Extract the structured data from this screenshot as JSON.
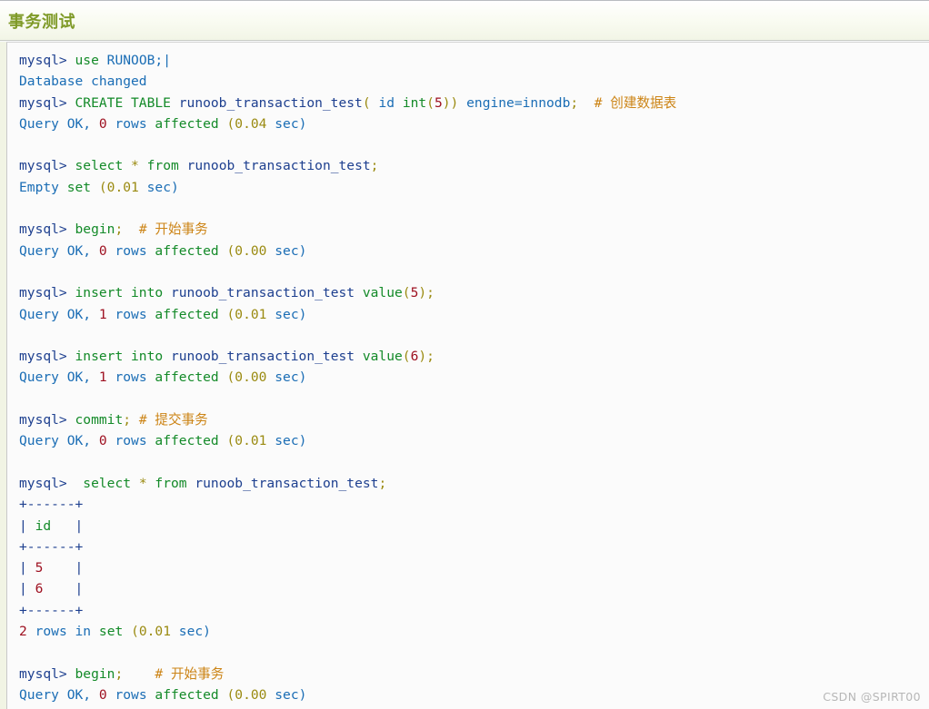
{
  "header": {
    "title": "事务测试",
    "title_color": "#7f9a28"
  },
  "watermark": {
    "text": "CSDN @SPIRT00"
  },
  "colors": {
    "prompt": "#1d3f8f",
    "keyword": "#138a28",
    "identifier": "#1a6db5",
    "number": "#9e1020",
    "punctuation": "#9a8a10",
    "comment": "#cc8416",
    "table_border": "#1d3f8f",
    "code_background": "#fbfbfb",
    "page_background": "#f1f4e4",
    "header_background": "#f2f5e6"
  },
  "terminal": {
    "lines": [
      {
        "id": "l01",
        "tokens": [
          {
            "t": "mysql>",
            "c": "prompt"
          },
          {
            "t": " ",
            "c": "plain"
          },
          {
            "t": "use",
            "c": "kw"
          },
          {
            "t": " ",
            "c": "plain"
          },
          {
            "t": "RUNOOB;",
            "c": "ident"
          },
          {
            "t": "|",
            "c": "ident"
          }
        ]
      },
      {
        "id": "l02",
        "tokens": [
          {
            "t": "Database changed",
            "c": "plain"
          }
        ]
      },
      {
        "id": "l03",
        "tokens": [
          {
            "t": "mysql>",
            "c": "prompt"
          },
          {
            "t": " ",
            "c": "plain"
          },
          {
            "t": "CREATE TABLE",
            "c": "kw"
          },
          {
            "t": " ",
            "c": "plain"
          },
          {
            "t": "runoob_transaction_test",
            "c": "tbl"
          },
          {
            "t": "(",
            "c": "punct"
          },
          {
            "t": " ",
            "c": "plain"
          },
          {
            "t": "id",
            "c": "ident"
          },
          {
            "t": " ",
            "c": "plain"
          },
          {
            "t": "int",
            "c": "kw"
          },
          {
            "t": "(",
            "c": "punct"
          },
          {
            "t": "5",
            "c": "num"
          },
          {
            "t": "))",
            "c": "punct"
          },
          {
            "t": " engine=innodb",
            "c": "ident"
          },
          {
            "t": ";",
            "c": "punct"
          },
          {
            "t": "  # 创建数据表",
            "c": "comment"
          }
        ]
      },
      {
        "id": "l04",
        "tokens": [
          {
            "t": "Query OK,",
            "c": "plain"
          },
          {
            "t": " ",
            "c": "plain"
          },
          {
            "t": "0",
            "c": "num"
          },
          {
            "t": " ",
            "c": "plain"
          },
          {
            "t": "rows",
            "c": "plain"
          },
          {
            "t": " ",
            "c": "plain"
          },
          {
            "t": "affected",
            "c": "kw"
          },
          {
            "t": " ",
            "c": "plain"
          },
          {
            "t": "(0.04",
            "c": "punct"
          },
          {
            "t": " ",
            "c": "plain"
          },
          {
            "t": "sec)",
            "c": "plain"
          }
        ]
      },
      {
        "id": "l05",
        "tokens": []
      },
      {
        "id": "l06",
        "tokens": [
          {
            "t": "mysql>",
            "c": "prompt"
          },
          {
            "t": " ",
            "c": "plain"
          },
          {
            "t": "select",
            "c": "kw"
          },
          {
            "t": " ",
            "c": "plain"
          },
          {
            "t": "*",
            "c": "punct"
          },
          {
            "t": " ",
            "c": "plain"
          },
          {
            "t": "from",
            "c": "kw"
          },
          {
            "t": " ",
            "c": "plain"
          },
          {
            "t": "runoob_transaction_test",
            "c": "tbl"
          },
          {
            "t": ";",
            "c": "punct"
          }
        ]
      },
      {
        "id": "l07",
        "tokens": [
          {
            "t": "Empty",
            "c": "plain"
          },
          {
            "t": " ",
            "c": "plain"
          },
          {
            "t": "set",
            "c": "kw"
          },
          {
            "t": " ",
            "c": "plain"
          },
          {
            "t": "(0.01",
            "c": "punct"
          },
          {
            "t": " ",
            "c": "plain"
          },
          {
            "t": "sec)",
            "c": "plain"
          }
        ]
      },
      {
        "id": "l08",
        "tokens": []
      },
      {
        "id": "l09",
        "tokens": [
          {
            "t": "mysql>",
            "c": "prompt"
          },
          {
            "t": " ",
            "c": "plain"
          },
          {
            "t": "begin",
            "c": "kw"
          },
          {
            "t": ";",
            "c": "punct"
          },
          {
            "t": "  # 开始事务",
            "c": "comment"
          }
        ]
      },
      {
        "id": "l10",
        "tokens": [
          {
            "t": "Query OK,",
            "c": "plain"
          },
          {
            "t": " ",
            "c": "plain"
          },
          {
            "t": "0",
            "c": "num"
          },
          {
            "t": " ",
            "c": "plain"
          },
          {
            "t": "rows",
            "c": "plain"
          },
          {
            "t": " ",
            "c": "plain"
          },
          {
            "t": "affected",
            "c": "kw"
          },
          {
            "t": " ",
            "c": "plain"
          },
          {
            "t": "(0.00",
            "c": "punct"
          },
          {
            "t": " ",
            "c": "plain"
          },
          {
            "t": "sec)",
            "c": "plain"
          }
        ]
      },
      {
        "id": "l11",
        "tokens": []
      },
      {
        "id": "l12",
        "tokens": [
          {
            "t": "mysql>",
            "c": "prompt"
          },
          {
            "t": " ",
            "c": "plain"
          },
          {
            "t": "insert into",
            "c": "kw"
          },
          {
            "t": " ",
            "c": "plain"
          },
          {
            "t": "runoob_transaction_test",
            "c": "tbl"
          },
          {
            "t": " ",
            "c": "plain"
          },
          {
            "t": "value",
            "c": "kw"
          },
          {
            "t": "(",
            "c": "punct"
          },
          {
            "t": "5",
            "c": "num"
          },
          {
            "t": ");",
            "c": "punct"
          }
        ]
      },
      {
        "id": "l13",
        "tokens": [
          {
            "t": "Query OK,",
            "c": "plain"
          },
          {
            "t": " ",
            "c": "plain"
          },
          {
            "t": "1",
            "c": "num"
          },
          {
            "t": " ",
            "c": "plain"
          },
          {
            "t": "rows",
            "c": "plain"
          },
          {
            "t": " ",
            "c": "plain"
          },
          {
            "t": "affected",
            "c": "kw"
          },
          {
            "t": " ",
            "c": "plain"
          },
          {
            "t": "(0.01",
            "c": "punct"
          },
          {
            "t": " ",
            "c": "plain"
          },
          {
            "t": "sec)",
            "c": "plain"
          }
        ]
      },
      {
        "id": "l14",
        "tokens": []
      },
      {
        "id": "l15",
        "tokens": [
          {
            "t": "mysql>",
            "c": "prompt"
          },
          {
            "t": " ",
            "c": "plain"
          },
          {
            "t": "insert into",
            "c": "kw"
          },
          {
            "t": " ",
            "c": "plain"
          },
          {
            "t": "runoob_transaction_test",
            "c": "tbl"
          },
          {
            "t": " ",
            "c": "plain"
          },
          {
            "t": "value",
            "c": "kw"
          },
          {
            "t": "(",
            "c": "punct"
          },
          {
            "t": "6",
            "c": "num"
          },
          {
            "t": ");",
            "c": "punct"
          }
        ]
      },
      {
        "id": "l16",
        "tokens": [
          {
            "t": "Query OK,",
            "c": "plain"
          },
          {
            "t": " ",
            "c": "plain"
          },
          {
            "t": "1",
            "c": "num"
          },
          {
            "t": " ",
            "c": "plain"
          },
          {
            "t": "rows",
            "c": "plain"
          },
          {
            "t": " ",
            "c": "plain"
          },
          {
            "t": "affected",
            "c": "kw"
          },
          {
            "t": " ",
            "c": "plain"
          },
          {
            "t": "(0.00",
            "c": "punct"
          },
          {
            "t": " ",
            "c": "plain"
          },
          {
            "t": "sec)",
            "c": "plain"
          }
        ]
      },
      {
        "id": "l17",
        "tokens": []
      },
      {
        "id": "l18",
        "tokens": [
          {
            "t": "mysql>",
            "c": "prompt"
          },
          {
            "t": " ",
            "c": "plain"
          },
          {
            "t": "commit",
            "c": "kw"
          },
          {
            "t": ";",
            "c": "punct"
          },
          {
            "t": " # 提交事务",
            "c": "comment"
          }
        ]
      },
      {
        "id": "l19",
        "tokens": [
          {
            "t": "Query OK,",
            "c": "plain"
          },
          {
            "t": " ",
            "c": "plain"
          },
          {
            "t": "0",
            "c": "num"
          },
          {
            "t": " ",
            "c": "plain"
          },
          {
            "t": "rows",
            "c": "plain"
          },
          {
            "t": " ",
            "c": "plain"
          },
          {
            "t": "affected",
            "c": "kw"
          },
          {
            "t": " ",
            "c": "plain"
          },
          {
            "t": "(0.01",
            "c": "punct"
          },
          {
            "t": " ",
            "c": "plain"
          },
          {
            "t": "sec)",
            "c": "plain"
          }
        ]
      },
      {
        "id": "l20",
        "tokens": []
      },
      {
        "id": "l21",
        "tokens": [
          {
            "t": "mysql>",
            "c": "prompt"
          },
          {
            "t": "  ",
            "c": "plain"
          },
          {
            "t": "select",
            "c": "kw"
          },
          {
            "t": " ",
            "c": "plain"
          },
          {
            "t": "*",
            "c": "punct"
          },
          {
            "t": " ",
            "c": "plain"
          },
          {
            "t": "from",
            "c": "kw"
          },
          {
            "t": " ",
            "c": "plain"
          },
          {
            "t": "runoob_transaction_test",
            "c": "tbl"
          },
          {
            "t": ";",
            "c": "punct"
          }
        ]
      },
      {
        "id": "l22",
        "tokens": [
          {
            "t": "+------+",
            "c": "tbl"
          }
        ]
      },
      {
        "id": "l23",
        "tokens": [
          {
            "t": "| ",
            "c": "tbl"
          },
          {
            "t": "id",
            "c": "kw"
          },
          {
            "t": "   |",
            "c": "tbl"
          }
        ]
      },
      {
        "id": "l24",
        "tokens": [
          {
            "t": "+------+",
            "c": "tbl"
          }
        ]
      },
      {
        "id": "l25",
        "tokens": [
          {
            "t": "| ",
            "c": "tbl"
          },
          {
            "t": "5",
            "c": "num"
          },
          {
            "t": "    |",
            "c": "tbl"
          }
        ]
      },
      {
        "id": "l26",
        "tokens": [
          {
            "t": "| ",
            "c": "tbl"
          },
          {
            "t": "6",
            "c": "num"
          },
          {
            "t": "    |",
            "c": "tbl"
          }
        ]
      },
      {
        "id": "l27",
        "tokens": [
          {
            "t": "+------+",
            "c": "tbl"
          }
        ]
      },
      {
        "id": "l28",
        "tokens": [
          {
            "t": "2",
            "c": "num"
          },
          {
            "t": " ",
            "c": "plain"
          },
          {
            "t": "rows in",
            "c": "plain"
          },
          {
            "t": " ",
            "c": "plain"
          },
          {
            "t": "set",
            "c": "kw"
          },
          {
            "t": " ",
            "c": "plain"
          },
          {
            "t": "(0.01",
            "c": "punct"
          },
          {
            "t": " ",
            "c": "plain"
          },
          {
            "t": "sec)",
            "c": "plain"
          }
        ]
      },
      {
        "id": "l29",
        "tokens": []
      },
      {
        "id": "l30",
        "tokens": [
          {
            "t": "mysql>",
            "c": "prompt"
          },
          {
            "t": " ",
            "c": "plain"
          },
          {
            "t": "begin",
            "c": "kw"
          },
          {
            "t": ";",
            "c": "punct"
          },
          {
            "t": "    # 开始事务",
            "c": "comment"
          }
        ]
      },
      {
        "id": "l31",
        "tokens": [
          {
            "t": "Query OK,",
            "c": "plain"
          },
          {
            "t": " ",
            "c": "plain"
          },
          {
            "t": "0",
            "c": "num"
          },
          {
            "t": " ",
            "c": "plain"
          },
          {
            "t": "rows",
            "c": "plain"
          },
          {
            "t": " ",
            "c": "plain"
          },
          {
            "t": "affected",
            "c": "kw"
          },
          {
            "t": " ",
            "c": "plain"
          },
          {
            "t": "(0.00",
            "c": "punct"
          },
          {
            "t": " ",
            "c": "plain"
          },
          {
            "t": "sec)",
            "c": "plain"
          }
        ]
      }
    ]
  }
}
